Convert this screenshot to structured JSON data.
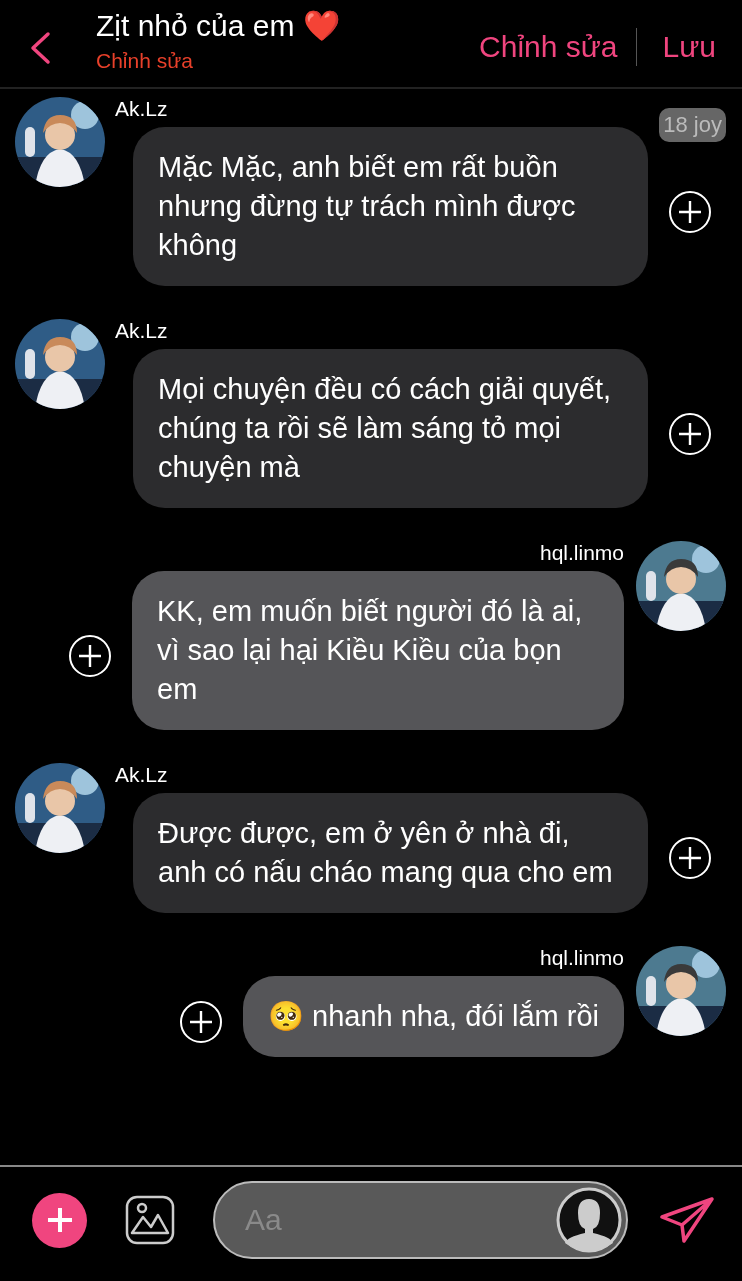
{
  "header": {
    "title": "Zịt nhỏ của em ❤️",
    "subtitle": "Chỉnh sửa",
    "actions": [
      "Chỉnh sửa",
      "Lưu"
    ]
  },
  "badge": "18 joy",
  "messages": [
    {
      "kind": "left",
      "sender": "Ak.Lz",
      "text": "Mặc Mặc, anh biết em rất buồn nhưng đừng tự trách mình được không"
    },
    {
      "kind": "left",
      "sender": "Ak.Lz",
      "text": "Mọi chuyện đều có cách giải quyết, chúng ta rồi sẽ làm sáng tỏ mọi chuyện mà"
    },
    {
      "kind": "right",
      "sender": "hql.linmo",
      "text": "KK, em muốn biết người đó là ai, vì sao lại hại Kiều Kiều của bọn em"
    },
    {
      "kind": "left",
      "sender": "Ak.Lz",
      "text": "Được được, em ở yên ở nhà đi, anh có nấu cháo mang qua cho em"
    },
    {
      "kind": "right",
      "sender": "hql.linmo",
      "text": "🥺 nhanh nha, đói lắm rồi"
    }
  ],
  "composer": {
    "placeholder": "Aa"
  }
}
